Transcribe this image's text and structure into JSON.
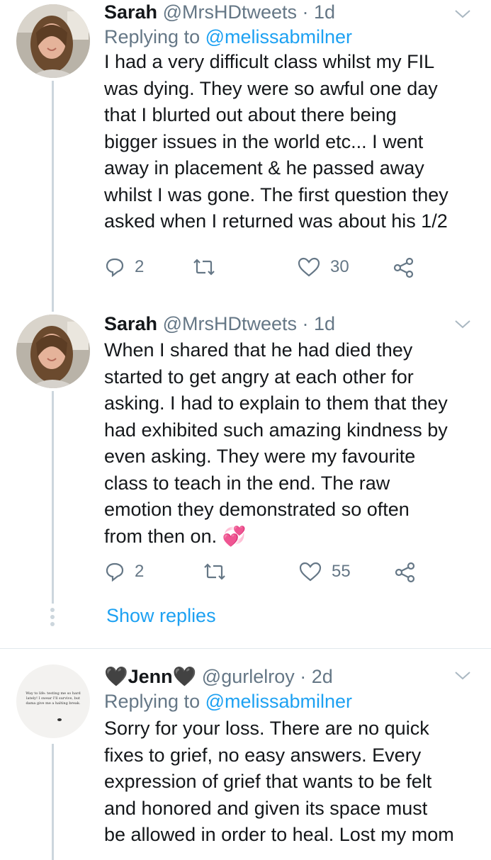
{
  "tweets": [
    {
      "name": "Sarah",
      "handle": "@MrsHDtweets",
      "dot": "·",
      "time": "1d",
      "reply_prefix": "Replying to ",
      "reply_to": "@melissabmilner",
      "text": "I had a very difficult class whilst my FIL\nwas dying. They were so awful one day\nthat I blurted out about there being\nbigger issues in the world etc... I went\naway in placement & he passed away\nwhilst I was gone. The first question they\nasked when I returned was about his 1/2",
      "replies": "2",
      "retweets": "",
      "likes": "30"
    },
    {
      "name": "Sarah",
      "handle": "@MrsHDtweets",
      "dot": "·",
      "time": "1d",
      "text": "When I shared that he had died they\nstarted to get angry at each other for\nasking. I had to explain to them that they\nhad exhibited such amazing kindness by\neven asking. They were my favourite\nclass to teach in the end. The raw\nemotion they demonstrated so often\nfrom then on.",
      "emoji": "💞",
      "replies": "2",
      "retweets": "",
      "likes": "55"
    },
    {
      "name": "Jenn",
      "name_prefix_emoji": "🖤",
      "name_suffix_emoji": "🖤",
      "handle": "@gurlelroy",
      "dot": "·",
      "time": "2d",
      "reply_prefix": "Replying to ",
      "reply_to": "@melissabmilner",
      "text": "Sorry for your loss. There are no quick\nfixes to grief, no easy answers. Every\nexpression of grief that wants to be felt\nand honored and given its space must\nbe allowed in order to heal. Lost my mom",
      "avatar_text": "Way to life: testing me so hard lately! I swear I'll survive, but dama give me a halting break."
    }
  ],
  "show_replies": "Show replies",
  "icons": {
    "reply": "reply-icon",
    "retweet": "retweet-icon",
    "like": "heart-icon",
    "share": "share-icon",
    "chevron": "chevron-down-icon"
  },
  "colors": {
    "link": "#1da1f2",
    "secondary": "#657786",
    "line": "#ccd6dd"
  }
}
